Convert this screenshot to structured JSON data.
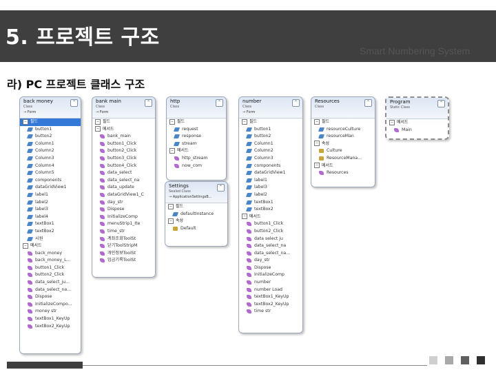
{
  "header": {
    "title": "5. 프로젝트 구조",
    "brand": "Smart Numbering System"
  },
  "subtitle": "라) PC 프로젝트 클래스 구조",
  "colors": {
    "header_bg": "#3f3f3f",
    "selection": "#3478d8"
  },
  "classes": [
    {
      "name": "back money",
      "kind": "Class",
      "base": "→ Form",
      "sections": [
        {
          "label": "필드",
          "selected": true,
          "members": [
            {
              "t": "field",
              "label": "button1"
            },
            {
              "t": "field",
              "label": "button2"
            },
            {
              "t": "field",
              "label": "Column1"
            },
            {
              "t": "field",
              "label": "Column2"
            },
            {
              "t": "field",
              "label": "Column3"
            },
            {
              "t": "field",
              "label": "Column4"
            },
            {
              "t": "field",
              "label": "Column5"
            },
            {
              "t": "field",
              "label": "components"
            },
            {
              "t": "field",
              "label": "dataGridView1"
            },
            {
              "t": "field",
              "label": "label1"
            },
            {
              "t": "field",
              "label": "label2"
            },
            {
              "t": "field",
              "label": "label3"
            },
            {
              "t": "field",
              "label": "label4"
            },
            {
              "t": "field",
              "label": "textBox1"
            },
            {
              "t": "field",
              "label": "textBox2"
            },
            {
              "t": "field",
              "label": "시원"
            }
          ]
        },
        {
          "label": "메서드",
          "members": [
            {
              "t": "method",
              "label": "back_money"
            },
            {
              "t": "method",
              "label": "back_money_L..."
            },
            {
              "t": "method",
              "label": "button1_Click"
            },
            {
              "t": "method",
              "label": "button2_Click"
            },
            {
              "t": "method",
              "label": "data_select_ju..."
            },
            {
              "t": "method",
              "label": "data_select_na..."
            },
            {
              "t": "method",
              "label": "Dispose"
            },
            {
              "t": "method",
              "label": "InitializeCompo..."
            },
            {
              "t": "method",
              "label": "money str"
            },
            {
              "t": "method",
              "label": "textBox1_KeyUp"
            },
            {
              "t": "method",
              "label": "textBox2_KeyUp"
            }
          ]
        }
      ]
    },
    {
      "name": "bank main",
      "kind": "Class",
      "base": "→ Form",
      "sections": [
        {
          "label": "필드",
          "members": []
        },
        {
          "label": "메서드",
          "members": [
            {
              "t": "method",
              "label": "bank_main"
            },
            {
              "t": "method",
              "label": "button1_Click"
            },
            {
              "t": "method",
              "label": "button2_Click"
            },
            {
              "t": "method",
              "label": "button3_Click"
            },
            {
              "t": "method",
              "label": "button4_Click"
            },
            {
              "t": "method",
              "label": "data_select"
            },
            {
              "t": "method",
              "label": "data_select_na"
            },
            {
              "t": "method",
              "label": "data_update"
            },
            {
              "t": "method",
              "label": "dataGridView1_C"
            },
            {
              "t": "method",
              "label": "day_str"
            },
            {
              "t": "method",
              "label": "Dispose"
            },
            {
              "t": "method",
              "label": "InitializeComp"
            },
            {
              "t": "method",
              "label": "menuStrip1_Ite"
            },
            {
              "t": "method",
              "label": "time_str"
            },
            {
              "t": "method",
              "label": "계좌조회ToolSt"
            },
            {
              "t": "method",
              "label": "닫기ToolStripM"
            },
            {
              "t": "method",
              "label": "개인정보ToolSt"
            },
            {
              "t": "method",
              "label": "입금기록ToolSt"
            }
          ]
        }
      ]
    },
    {
      "name": "http",
      "kind": "Class",
      "base": "",
      "sections": [
        {
          "label": "필드",
          "members": [
            {
              "t": "field",
              "label": "request"
            },
            {
              "t": "field",
              "label": "response"
            },
            {
              "t": "field",
              "label": "stream"
            }
          ]
        },
        {
          "label": "메서드",
          "members": [
            {
              "t": "method",
              "label": "http_stream"
            },
            {
              "t": "method",
              "label": "now_com"
            }
          ]
        }
      ]
    },
    {
      "name": "Settings",
      "kind": "Sealed Class",
      "base": "→ ApplicationSettingsB...",
      "sections": [
        {
          "label": "필드",
          "members": [
            {
              "t": "field",
              "label": "defaultInstance"
            }
          ]
        },
        {
          "label": "속성",
          "members": [
            {
              "t": "prop",
              "label": "Default"
            }
          ]
        }
      ]
    },
    {
      "name": "number",
      "kind": "Class",
      "base": "→ Form",
      "sections": [
        {
          "label": "필드",
          "members": [
            {
              "t": "field",
              "label": "button1"
            },
            {
              "t": "field",
              "label": "button2"
            },
            {
              "t": "field",
              "label": "Column1"
            },
            {
              "t": "field",
              "label": "Column2"
            },
            {
              "t": "field",
              "label": "Column3"
            },
            {
              "t": "field",
              "label": "components"
            },
            {
              "t": "field",
              "label": "dataGridView1"
            },
            {
              "t": "field",
              "label": "label1"
            },
            {
              "t": "field",
              "label": "label3"
            },
            {
              "t": "field",
              "label": "label2"
            },
            {
              "t": "field",
              "label": "textBox1"
            },
            {
              "t": "field",
              "label": "textBox2"
            }
          ]
        },
        {
          "label": "메서드",
          "members": [
            {
              "t": "method",
              "label": "button1_Click"
            },
            {
              "t": "method",
              "label": "button2_Click"
            },
            {
              "t": "method",
              "label": "data select ju"
            },
            {
              "t": "method",
              "label": "data_select_na"
            },
            {
              "t": "method",
              "label": "data_select_na..."
            },
            {
              "t": "method",
              "label": "day_str"
            },
            {
              "t": "method",
              "label": "Dispose"
            },
            {
              "t": "method",
              "label": "InitializeComp"
            },
            {
              "t": "method",
              "label": "number"
            },
            {
              "t": "method",
              "label": "number Load"
            },
            {
              "t": "method",
              "label": "textBox1_KeyUp"
            },
            {
              "t": "method",
              "label": "textBox2_KeyUp"
            },
            {
              "t": "method",
              "label": "time str"
            }
          ]
        }
      ]
    },
    {
      "name": "Resources",
      "kind": "Class",
      "base": "",
      "sections": [
        {
          "label": "필드",
          "members": [
            {
              "t": "field",
              "label": "resourceCulture"
            },
            {
              "t": "field",
              "label": "resourceMan"
            }
          ]
        },
        {
          "label": "속성",
          "members": [
            {
              "t": "prop",
              "label": "Culture"
            },
            {
              "t": "prop",
              "label": "ResourceMana..."
            }
          ]
        },
        {
          "label": "메서드",
          "members": [
            {
              "t": "method",
              "label": "Resources"
            }
          ]
        }
      ]
    },
    {
      "name": "Program",
      "kind": "Static Class",
      "base": "",
      "sections": [
        {
          "label": "메서드",
          "members": [
            {
              "t": "method",
              "label": "Main"
            }
          ]
        }
      ]
    }
  ]
}
